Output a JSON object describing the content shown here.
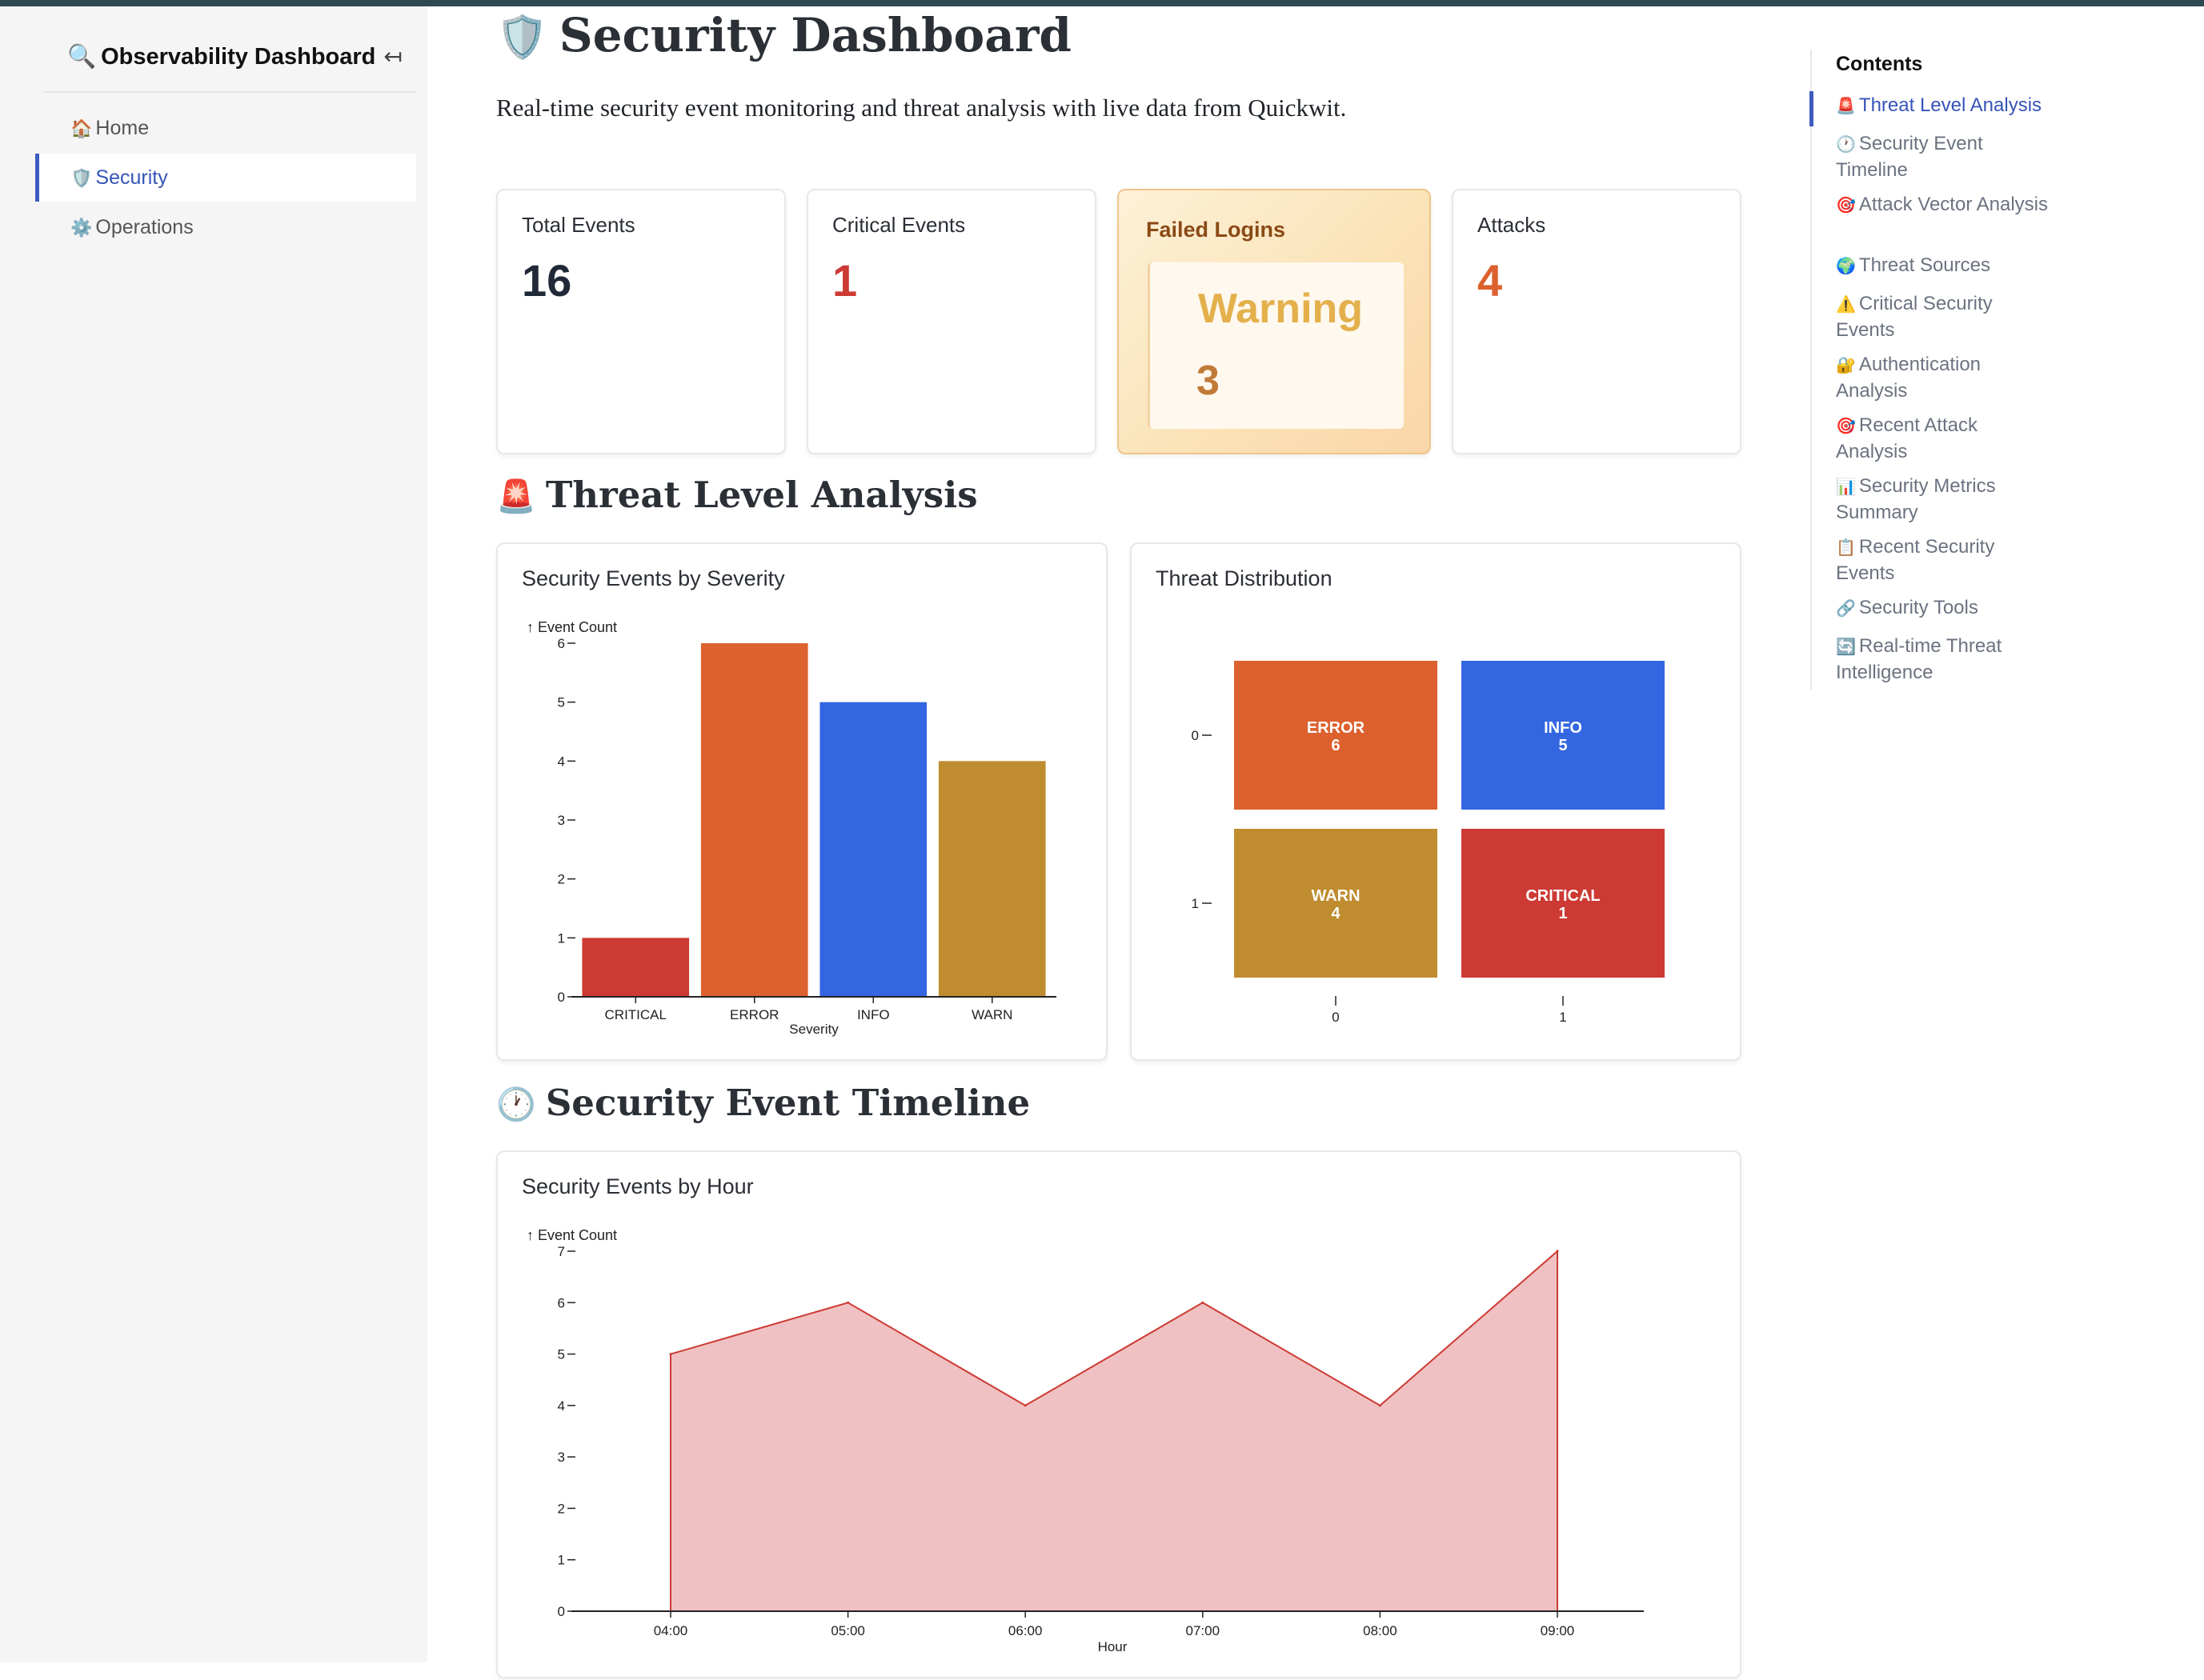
{
  "sidebar": {
    "brand": {
      "icon": "🔍",
      "title": "Observability Dashboard",
      "collapse_icon": "↤"
    },
    "items": [
      {
        "icon": "🏠",
        "label": "Home"
      },
      {
        "icon": "🛡️",
        "label": "Security",
        "active": true
      },
      {
        "icon": "⚙️",
        "label": "Operations"
      }
    ]
  },
  "page": {
    "icon": "🛡️",
    "title": "Security Dashboard",
    "description": "Real-time security event monitoring and threat analysis with live data from Quickwit."
  },
  "stats": {
    "total": {
      "label": "Total Events",
      "value": "16"
    },
    "critical": {
      "label": "Critical Events",
      "value": "1"
    },
    "failed": {
      "label": "Failed Logins",
      "status": "Warning",
      "value": "3"
    },
    "attacks": {
      "label": "Attacks",
      "value": "4"
    }
  },
  "sections": {
    "threat": {
      "icon": "🚨",
      "title": "Threat Level Analysis"
    },
    "timeline": {
      "icon": "🕐",
      "title": "Security Event Timeline"
    }
  },
  "charts": {
    "severity": {
      "title": "Security Events by Severity"
    },
    "distribution": {
      "title": "Threat Distribution"
    },
    "hourly": {
      "title": "Security Events by Hour"
    }
  },
  "chart_data": [
    {
      "type": "bar",
      "title": "Security Events by Severity",
      "xlabel": "Severity",
      "ylabel": "↑ Event Count",
      "categories": [
        "CRITICAL",
        "ERROR",
        "INFO",
        "WARN"
      ],
      "values": [
        1,
        6,
        5,
        4
      ],
      "colors": [
        "#cc3a33",
        "#dc612e",
        "#3366e0",
        "#c08c30"
      ],
      "ylim": [
        0,
        6
      ],
      "yticks": [
        0,
        1,
        2,
        3,
        4,
        5,
        6
      ]
    },
    {
      "type": "heatmap",
      "title": "Threat Distribution",
      "x": [
        "0",
        "1"
      ],
      "y": [
        "0",
        "1"
      ],
      "cells": [
        {
          "col": 0,
          "row": 0,
          "label": "ERROR",
          "value": 6,
          "color": "#dc612e"
        },
        {
          "col": 1,
          "row": 0,
          "label": "INFO",
          "value": 5,
          "color": "#3366e0"
        },
        {
          "col": 0,
          "row": 1,
          "label": "WARN",
          "value": 4,
          "color": "#c08c30"
        },
        {
          "col": 1,
          "row": 1,
          "label": "CRITICAL",
          "value": 1,
          "color": "#cc3a33"
        }
      ]
    },
    {
      "type": "area",
      "title": "Security Events by Hour",
      "xlabel": "Hour",
      "ylabel": "↑ Event Count",
      "x": [
        "04:00",
        "05:00",
        "06:00",
        "07:00",
        "08:00",
        "09:00"
      ],
      "values": [
        5,
        6,
        4,
        6,
        4,
        7
      ],
      "ylim": [
        0,
        7
      ],
      "yticks": [
        0,
        1,
        2,
        3,
        4,
        5,
        6,
        7
      ],
      "fill": "#f0c1c2",
      "stroke": "#cc3a33"
    }
  ],
  "colors": {
    "accent": "#3654b8",
    "critical": "#cc3a33",
    "attacks": "#dc612e",
    "warning": "#e3b04b",
    "warning_value": "#c07a37"
  },
  "toc": {
    "heading": "Contents",
    "items": [
      {
        "icon": "🚨",
        "label": "Threat Level Analysis",
        "active": true
      },
      {
        "icon": "🕐",
        "label": "Security Event Timeline"
      },
      {
        "icon": "🎯",
        "label": "Attack Vector Analysis"
      },
      {
        "icon": "🌍",
        "label": "Threat Sources"
      },
      {
        "icon": "⚠️",
        "label": "Critical Security Events"
      },
      {
        "icon": "🔐",
        "label": "Authentication Analysis"
      },
      {
        "icon": "🎯",
        "label": "Recent Attack Analysis"
      },
      {
        "icon": "📊",
        "label": "Security Metrics Summary"
      },
      {
        "icon": "📋",
        "label": "Recent Security Events"
      },
      {
        "icon": "🔗",
        "label": "Security Tools"
      },
      {
        "icon": "🔄",
        "label": "Real-time Threat Intelligence"
      }
    ]
  }
}
